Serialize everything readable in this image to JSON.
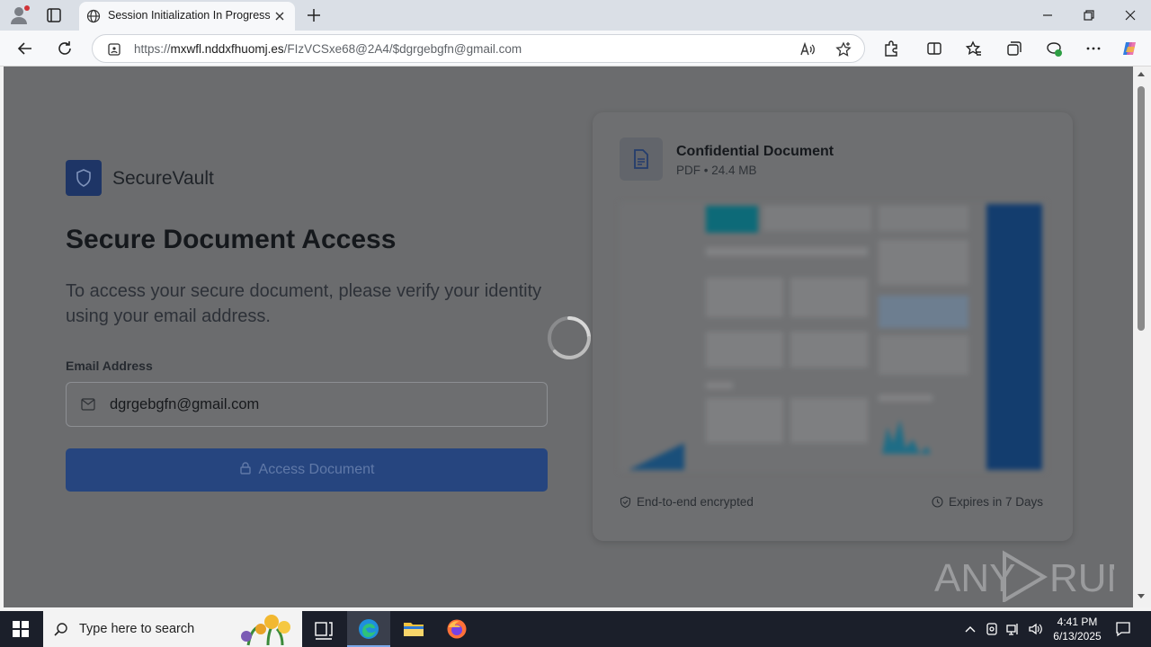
{
  "browser": {
    "tab_title": "Session Initialization In Progress",
    "url_prefix": "https://",
    "url_host": "mxwfl.nddxfhuomj.es",
    "url_path": "/FIzVCSxe68@2A4/$dgrgebgfn@gmail.com"
  },
  "page": {
    "brand": "SecureVault",
    "title": "Secure Document Access",
    "description": "To access your secure document, please verify your identity using your email address.",
    "email_label": "Email Address",
    "email_value": "dgrgebgfn@gmail.com",
    "access_button": "Access Document",
    "accent_color": "#26457f"
  },
  "card": {
    "doc_title": "Confidential Document",
    "doc_meta": "PDF • 24.4 MB",
    "encrypted_label": "End-to-end encrypted",
    "expires_label": "Expires in 7 Days"
  },
  "watermark": "ANY RUN",
  "taskbar": {
    "search_placeholder": "Type here to search",
    "time": "4:41 PM",
    "date": "6/13/2025"
  }
}
